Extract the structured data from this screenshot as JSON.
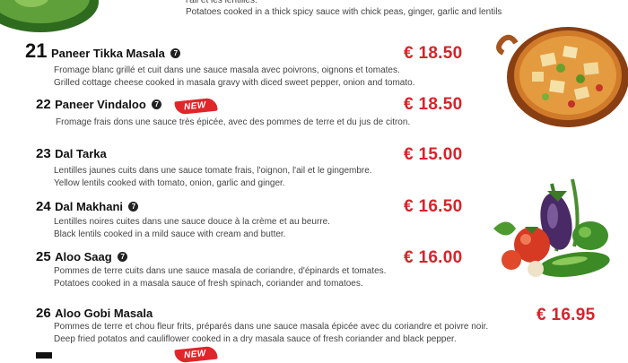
{
  "top": {
    "line1": "l'ail et les lentilles.",
    "line2": "Potatoes cooked in a thick spicy sauce with chick peas, ginger, garlic and lentils"
  },
  "items": [
    {
      "number": "21",
      "name": "Paneer Tikka Masala",
      "fr": "Fromage blanc grillé et cuit dans une sauce masala avec poivrons, oignons et tomates.",
      "en": "Grilled cottage cheese cooked in masala gravy with diced sweet pepper, onion and tomato.",
      "price": "€ 18.50"
    },
    {
      "number": "22",
      "name": "Paneer Vindaloo",
      "badge": "NEW",
      "fr": "Fromage frais dons une sauce très épicée, avec des pommes de terre et du jus de citron.",
      "en": "",
      "price": "€ 18.50"
    },
    {
      "number": "23",
      "name": "Dal Tarka",
      "fr": "Lentilles jaunes cuits dans une sauce tomate frais, l'oignon, l'ail et le gingembre.",
      "en": "Yellow lentils cooked with tomato, onion, garlic and ginger.",
      "price": "€ 15.00"
    },
    {
      "number": "24",
      "name": "Dal Makhani",
      "fr": "Lentilles noires cuites dans une sauce douce à la crème et au beurre.",
      "en": "Black lentils cooked in a mild sauce with cream and butter.",
      "price": "€ 16.50"
    },
    {
      "number": "25",
      "name": "Aloo Saag",
      "fr": "Pommes de terre cuits dans une sauce masala de coriandre, d'épinards et tomates.",
      "en": "Potatoes cooked in a masala sauce of fresh spinach, coriander and tomatoes.",
      "price": "€ 16.00"
    },
    {
      "number": "26",
      "name": "Aloo Gobi Masala",
      "fr": "Pommes de terre et chou fleur frits, préparés dans une sauce masala épicée avec du coriandre et poivre noir.",
      "en": "Deep fried potatos and cauliflower cooked in a dry masala sauce of fresh coriander and black pepper.",
      "price": "€ 16.95"
    }
  ],
  "badge_symbol": "7",
  "next_badge": "NEW",
  "colors": {
    "price": "#d8232a",
    "badge": "#e0262b"
  }
}
